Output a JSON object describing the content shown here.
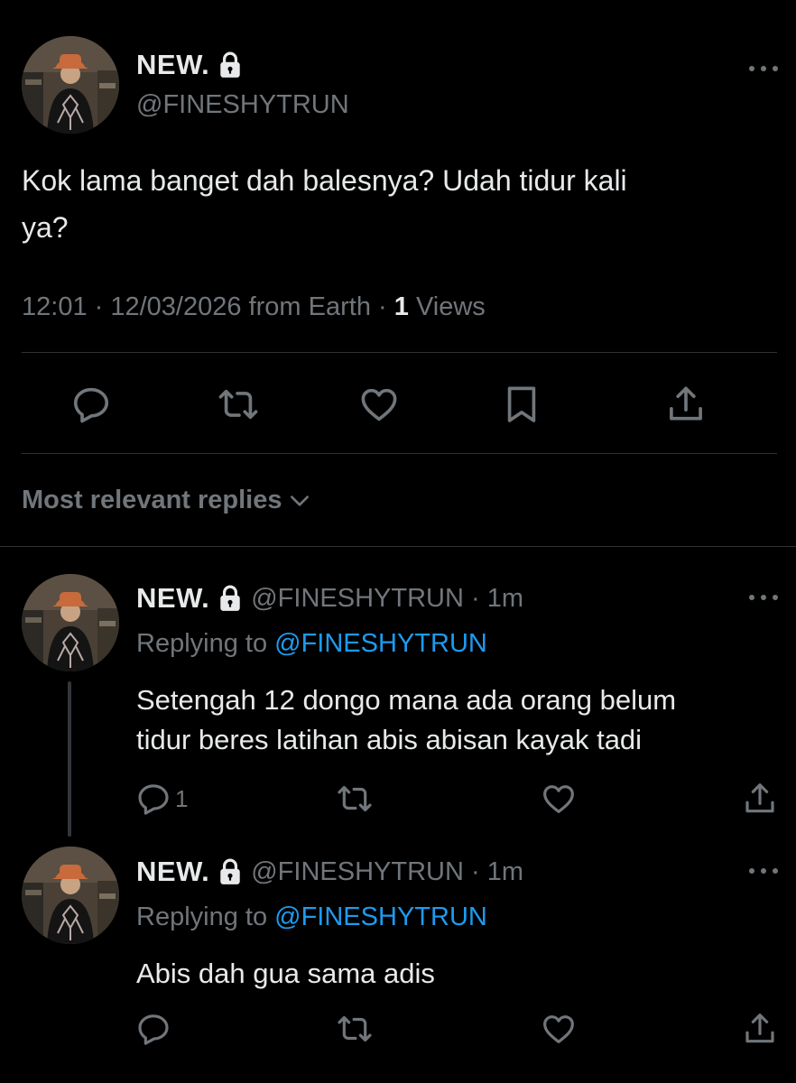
{
  "main_tweet": {
    "author_name": "NEW.",
    "author_handle": "@FINESHYTRUN",
    "text_line1": "Kok lama banget dah balesnya? Udah tidur kali",
    "text_line2": "ya?",
    "time": "12:01",
    "date": "12/03/2026",
    "source": "from Earth",
    "views_count": "1",
    "views_label": "Views",
    "icons": [
      "avatar",
      "lock-icon",
      "more-icon",
      "reply-icon",
      "retweet-icon",
      "like-icon",
      "bookmark-icon",
      "share-icon"
    ]
  },
  "replies_header": {
    "label": "Most relevant replies",
    "icon": "chevron-down-icon"
  },
  "replies": [
    {
      "author_name": "NEW.",
      "author_handle": "@FINESHYTRUN",
      "time": "1m",
      "replying_prefix": "Replying to",
      "replying_to": "@FINESHYTRUN",
      "text_line1": "Setengah 12 dongo mana ada orang belum",
      "text_line2": "tidur beres latihan abis abisan kayak tadi",
      "reply_count": "1"
    },
    {
      "author_name": "NEW.",
      "author_handle": "@FINESHYTRUN",
      "time": "1m",
      "replying_prefix": "Replying to",
      "replying_to": "@FINESHYTRUN",
      "text_line1": "Abis dah gua sama adis",
      "reply_count": ""
    }
  ],
  "colors": {
    "background": "#000000",
    "text": "#e7e9ea",
    "muted": "#71767b",
    "link": "#1d9bf0",
    "divider": "#2f3336"
  }
}
